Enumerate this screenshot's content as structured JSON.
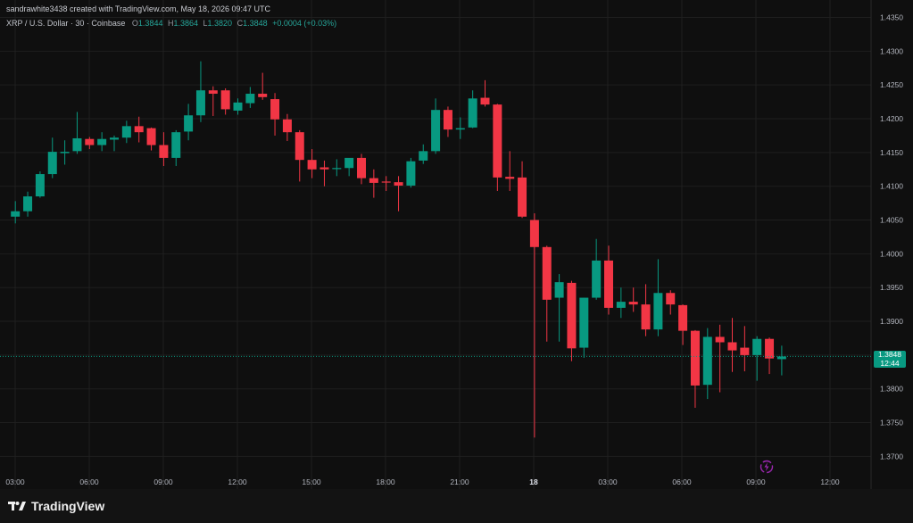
{
  "header": {
    "attribution": "sandrawhite3438 created with TradingView.com, May 18, 2026 09:47 UTC",
    "symbol": "XRP / U.S. Dollar · 30 · Coinbase",
    "o_label": "O",
    "o_value": "1.3844",
    "h_label": "H",
    "h_value": "1.3864",
    "l_label": "L",
    "l_value": "1.3820",
    "c_label": "C",
    "c_value": "1.3848",
    "change": "+0.0004 (+0.03%)"
  },
  "price_tag": {
    "price": "1.3848",
    "countdown": "12:44"
  },
  "footer": {
    "brand": "TradingView"
  },
  "colors": {
    "up": "#089981",
    "down": "#f23645",
    "background": "#0f0f0f",
    "grid": "#1f1f1f",
    "axis_text": "#b2b5be"
  },
  "chart_data": {
    "type": "candlestick",
    "interval_minutes": 30,
    "y_axis": {
      "position": "right",
      "range": [
        1.367,
        1.4345
      ],
      "ticks": [
        1.37,
        1.375,
        1.38,
        1.385,
        1.39,
        1.395,
        1.4,
        1.405,
        1.41,
        1.415,
        1.42,
        1.425,
        1.43,
        1.435
      ]
    },
    "x_axis": {
      "ticks": [
        "03:00",
        "06:00",
        "09:00",
        "12:00",
        "15:00",
        "18:00",
        "21:00",
        "18",
        "03:00",
        "06:00",
        "09:00",
        "12:00"
      ]
    },
    "last_price": 1.3848,
    "candles": [
      {
        "t": "May 17 03:00",
        "o": 1.4055,
        "h": 1.4078,
        "l": 1.4045,
        "c": 1.4063
      },
      {
        "t": "May 17 03:30",
        "o": 1.4063,
        "h": 1.4092,
        "l": 1.4055,
        "c": 1.4085
      },
      {
        "t": "May 17 04:00",
        "o": 1.4085,
        "h": 1.4122,
        "l": 1.4083,
        "c": 1.4118
      },
      {
        "t": "May 17 04:30",
        "o": 1.4118,
        "h": 1.4172,
        "l": 1.4112,
        "c": 1.4151
      },
      {
        "t": "May 17 05:00",
        "o": 1.4149,
        "h": 1.4168,
        "l": 1.4132,
        "c": 1.4151
      },
      {
        "t": "May 17 05:30",
        "o": 1.4152,
        "h": 1.421,
        "l": 1.4148,
        "c": 1.4171
      },
      {
        "t": "May 17 06:00",
        "o": 1.417,
        "h": 1.4173,
        "l": 1.4155,
        "c": 1.4161
      },
      {
        "t": "May 17 06:30",
        "o": 1.4161,
        "h": 1.418,
        "l": 1.4152,
        "c": 1.417
      },
      {
        "t": "May 17 07:00",
        "o": 1.4169,
        "h": 1.4175,
        "l": 1.4152,
        "c": 1.4172
      },
      {
        "t": "May 17 07:30",
        "o": 1.4172,
        "h": 1.4197,
        "l": 1.4164,
        "c": 1.4189
      },
      {
        "t": "May 17 08:00",
        "o": 1.4189,
        "h": 1.4203,
        "l": 1.4165,
        "c": 1.418
      },
      {
        "t": "May 17 08:30",
        "o": 1.4186,
        "h": 1.4187,
        "l": 1.4153,
        "c": 1.4161
      },
      {
        "t": "May 17 09:00",
        "o": 1.4161,
        "h": 1.418,
        "l": 1.413,
        "c": 1.4142
      },
      {
        "t": "May 17 09:30",
        "o": 1.4142,
        "h": 1.4183,
        "l": 1.413,
        "c": 1.418
      },
      {
        "t": "May 17 10:00",
        "o": 1.4181,
        "h": 1.4222,
        "l": 1.4168,
        "c": 1.4205
      },
      {
        "t": "May 17 10:30",
        "o": 1.4205,
        "h": 1.4285,
        "l": 1.4195,
        "c": 1.4242
      },
      {
        "t": "May 17 11:00",
        "o": 1.4242,
        "h": 1.4248,
        "l": 1.4204,
        "c": 1.4237
      },
      {
        "t": "May 17 11:30",
        "o": 1.4242,
        "h": 1.4245,
        "l": 1.4206,
        "c": 1.4214
      },
      {
        "t": "May 17 12:00",
        "o": 1.4212,
        "h": 1.423,
        "l": 1.4206,
        "c": 1.4224
      },
      {
        "t": "May 17 12:30",
        "o": 1.4223,
        "h": 1.4247,
        "l": 1.4216,
        "c": 1.4237
      },
      {
        "t": "May 17 13:00",
        "o": 1.4237,
        "h": 1.4268,
        "l": 1.4228,
        "c": 1.4232
      },
      {
        "t": "May 17 13:30",
        "o": 1.4229,
        "h": 1.4238,
        "l": 1.4175,
        "c": 1.4199
      },
      {
        "t": "May 17 14:00",
        "o": 1.4199,
        "h": 1.4207,
        "l": 1.4167,
        "c": 1.418
      },
      {
        "t": "May 17 14:30",
        "o": 1.418,
        "h": 1.4183,
        "l": 1.4107,
        "c": 1.4139
      },
      {
        "t": "May 17 15:00",
        "o": 1.4139,
        "h": 1.4155,
        "l": 1.4112,
        "c": 1.4125
      },
      {
        "t": "May 17 15:30",
        "o": 1.4128,
        "h": 1.4138,
        "l": 1.41,
        "c": 1.4125
      },
      {
        "t": "May 17 16:00",
        "o": 1.4126,
        "h": 1.414,
        "l": 1.4115,
        "c": 1.4127
      },
      {
        "t": "May 17 16:30",
        "o": 1.4127,
        "h": 1.414,
        "l": 1.4115,
        "c": 1.4142
      },
      {
        "t": "May 17 17:00",
        "o": 1.4142,
        "h": 1.4148,
        "l": 1.4103,
        "c": 1.4112
      },
      {
        "t": "May 17 17:30",
        "o": 1.4112,
        "h": 1.4125,
        "l": 1.4083,
        "c": 1.4105
      },
      {
        "t": "May 17 18:00",
        "o": 1.4107,
        "h": 1.4115,
        "l": 1.4093,
        "c": 1.4106
      },
      {
        "t": "May 17 18:30",
        "o": 1.4106,
        "h": 1.4115,
        "l": 1.4063,
        "c": 1.4101
      },
      {
        "t": "May 17 19:00",
        "o": 1.4101,
        "h": 1.4142,
        "l": 1.4098,
        "c": 1.4137
      },
      {
        "t": "May 17 19:30",
        "o": 1.4138,
        "h": 1.4162,
        "l": 1.4133,
        "c": 1.4152
      },
      {
        "t": "May 17 20:00",
        "o": 1.4152,
        "h": 1.423,
        "l": 1.4148,
        "c": 1.4213
      },
      {
        "t": "May 17 20:30",
        "o": 1.4213,
        "h": 1.4218,
        "l": 1.4173,
        "c": 1.4184
      },
      {
        "t": "May 17 21:00",
        "o": 1.4184,
        "h": 1.4202,
        "l": 1.417,
        "c": 1.4186
      },
      {
        "t": "May 17 21:30",
        "o": 1.4187,
        "h": 1.4242,
        "l": 1.4186,
        "c": 1.423
      },
      {
        "t": "May 17 22:00",
        "o": 1.4231,
        "h": 1.4257,
        "l": 1.4218,
        "c": 1.4221
      },
      {
        "t": "May 17 22:30",
        "o": 1.4221,
        "h": 1.4222,
        "l": 1.4093,
        "c": 1.4113
      },
      {
        "t": "May 17 23:00",
        "o": 1.4114,
        "h": 1.4152,
        "l": 1.4093,
        "c": 1.4111
      },
      {
        "t": "May 17 23:30",
        "o": 1.4113,
        "h": 1.4137,
        "l": 1.4053,
        "c": 1.4055
      },
      {
        "t": "May 18 00:00",
        "o": 1.405,
        "h": 1.406,
        "l": 1.3728,
        "c": 1.401
      },
      {
        "t": "May 18 00:30",
        "o": 1.401,
        "h": 1.4012,
        "l": 1.387,
        "c": 1.3932
      },
      {
        "t": "May 18 01:00",
        "o": 1.3935,
        "h": 1.397,
        "l": 1.387,
        "c": 1.3958
      },
      {
        "t": "May 18 01:30",
        "o": 1.3957,
        "h": 1.396,
        "l": 1.3841,
        "c": 1.386
      },
      {
        "t": "May 18 02:00",
        "o": 1.3861,
        "h": 1.3935,
        "l": 1.3846,
        "c": 1.3935
      },
      {
        "t": "May 18 02:30",
        "o": 1.3935,
        "h": 1.4022,
        "l": 1.3932,
        "c": 1.399
      },
      {
        "t": "May 18 03:00",
        "o": 1.399,
        "h": 1.4012,
        "l": 1.391,
        "c": 1.392
      },
      {
        "t": "May 18 03:30",
        "o": 1.392,
        "h": 1.395,
        "l": 1.3905,
        "c": 1.3929
      },
      {
        "t": "May 18 04:00",
        "o": 1.3929,
        "h": 1.395,
        "l": 1.3914,
        "c": 1.3925
      },
      {
        "t": "May 18 04:30",
        "o": 1.3925,
        "h": 1.3955,
        "l": 1.3878,
        "c": 1.3888
      },
      {
        "t": "May 18 05:00",
        "o": 1.3888,
        "h": 1.3992,
        "l": 1.3878,
        "c": 1.3942
      },
      {
        "t": "May 18 05:30",
        "o": 1.3942,
        "h": 1.3946,
        "l": 1.391,
        "c": 1.3925
      },
      {
        "t": "May 18 06:00",
        "o": 1.3924,
        "h": 1.3925,
        "l": 1.3865,
        "c": 1.3886
      },
      {
        "t": "May 18 06:30",
        "o": 1.3886,
        "h": 1.3887,
        "l": 1.3772,
        "c": 1.3805
      },
      {
        "t": "May 18 07:00",
        "o": 1.3806,
        "h": 1.389,
        "l": 1.3785,
        "c": 1.3877
      },
      {
        "t": "May 18 07:30",
        "o": 1.3877,
        "h": 1.3895,
        "l": 1.3795,
        "c": 1.3869
      },
      {
        "t": "May 18 08:00",
        "o": 1.3869,
        "h": 1.3905,
        "l": 1.3825,
        "c": 1.3857
      },
      {
        "t": "May 18 08:30",
        "o": 1.3861,
        "h": 1.3893,
        "l": 1.3826,
        "c": 1.385
      },
      {
        "t": "May 18 09:00",
        "o": 1.385,
        "h": 1.3878,
        "l": 1.3812,
        "c": 1.3874
      },
      {
        "t": "May 18 09:30",
        "o": 1.3874,
        "h": 1.3876,
        "l": 1.3822,
        "c": 1.3845
      },
      {
        "t": "May 18 10:00",
        "o": 1.3844,
        "h": 1.3864,
        "l": 1.382,
        "c": 1.3848
      }
    ]
  }
}
